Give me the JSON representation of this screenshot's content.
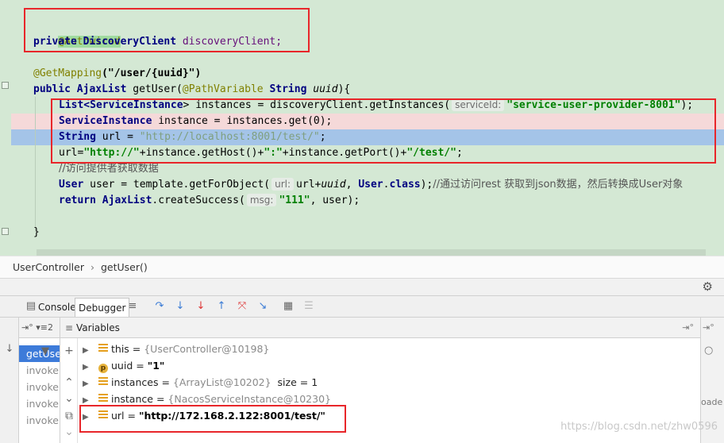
{
  "editor": {
    "line1": "@Autowired",
    "line2_kw": "private",
    "line2_type": "DiscoveryClient",
    "line2_field": "discoveryClient;",
    "line3_ann": "@GetMapping",
    "line3_rest": "(\"/user/{uuid}\")",
    "line4_kw": "public",
    "line4_type": "AjaxList",
    "line4_method": "getUser(",
    "line4_ann": "@PathVariable",
    "line4_ptype": "String",
    "line4_param": "uuid",
    "line4_end": "){",
    "line5_a": "List<",
    "line5_b": "ServiceInstance",
    "line5_c": "> instances = discoveryClient.getInstances(",
    "line5_hint": "serviceId:",
    "line5_str": "\"service-user-provider-8001\"",
    "line5_end": ");",
    "line6_type": "ServiceInstance",
    "line6_rest": "instance = instances.get(0);",
    "line7_type": "String",
    "line7_rest": "url = ",
    "line7_str": "\"http://localhost:8001/test/\"",
    "line7_end": ";",
    "line8_a": "url=",
    "line8_s1": "\"http://\"",
    "line8_b": "+instance.getHost()+",
    "line8_s2": "\":\"",
    "line8_c": "+instance.getPort()+",
    "line8_s3": "\"/test/\"",
    "line8_end": ";",
    "line9_comment": "//访问提供者获取数据",
    "line10_type": "User",
    "line10_a": "user = template.getForObject(",
    "line10_hint": "url:",
    "line10_b": "url+",
    "line10_param": "uuid",
    "line10_c": ", ",
    "line10_type2": "User",
    "line10_d": ".",
    "line10_kw": "class",
    "line10_e": ");",
    "line10_comment": "//通过访问rest 获取到json数据，然后转换成User对象",
    "line11_kw": "return",
    "line11_type": "AjaxList",
    "line11_a": ".createSuccess(",
    "line11_hint": "msg:",
    "line11_str": "\"111\"",
    "line11_b": ", user);",
    "line12": "}"
  },
  "breadcrumb": {
    "class_name": "UserController",
    "separator": "›",
    "method": "getUser()"
  },
  "toolbar": {
    "console_label": "Console",
    "debugger_label": "Debugger"
  },
  "frames": {
    "header": "⇥° ▾≡2",
    "items": [
      "getUse",
      "invoke",
      "invoke",
      "invoke",
      "invoke"
    ]
  },
  "variables": {
    "header": "Variables",
    "rows": [
      {
        "name": "this",
        "eq": " = ",
        "value": "{UserController@10198}",
        "icon": "field-icon"
      },
      {
        "name": "uuid",
        "eq": " = ",
        "value": "\"1\"",
        "icon": "parameter-icon"
      },
      {
        "name": "instances",
        "eq": " = ",
        "value": "{ArrayList@10202}",
        "extra": "size = 1",
        "icon": "field-icon"
      },
      {
        "name": "instance",
        "eq": " = ",
        "value": "{NacosServiceInstance@10230}",
        "icon": "field-icon"
      },
      {
        "name": "url",
        "eq": " = ",
        "value": "\"http://172.168.2.122:8001/test/\"",
        "icon": "field-icon"
      }
    ]
  },
  "right_panel": {
    "text": "oade"
  },
  "watermark": "https://blog.csdn.net/zhw0596",
  "colors": {
    "editor_bg": "#d4e8d4",
    "current_line": "#a4c4e8",
    "error_line": "#f5d9d9",
    "annotation_box": "#e8262a",
    "selected_frame": "#3d7bd9"
  }
}
